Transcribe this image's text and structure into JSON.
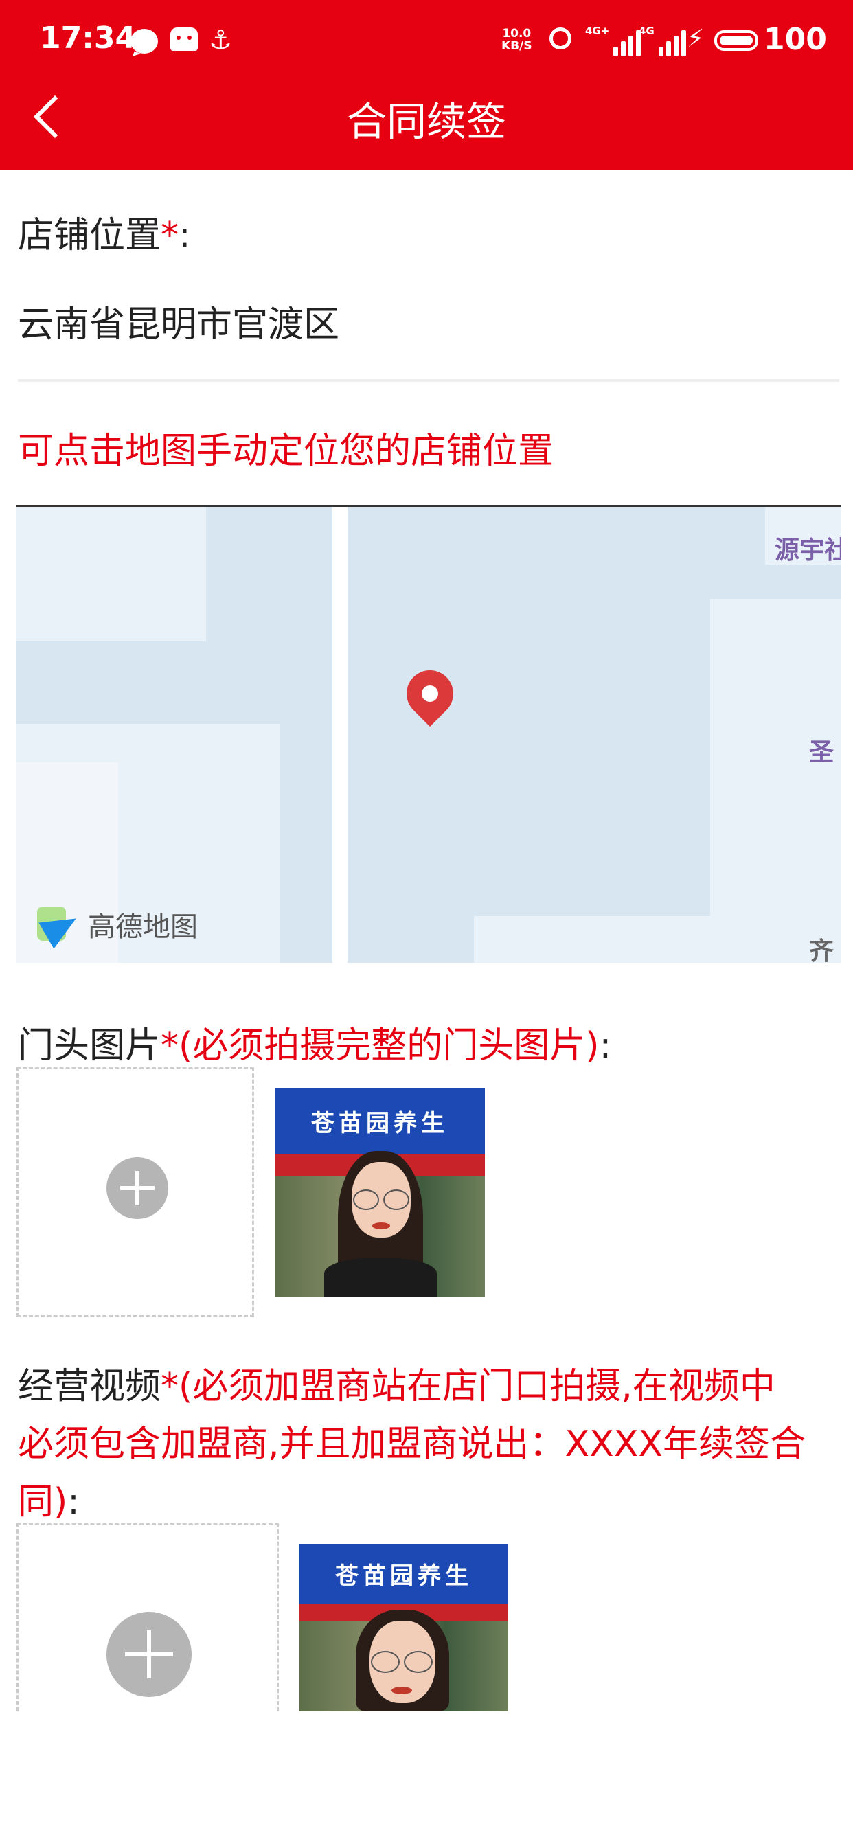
{
  "status_bar": {
    "time": "17:34",
    "net_speed_value": "10.0",
    "net_speed_unit": "KB/S",
    "signal1_label": "4G+",
    "signal2_label": "4G",
    "battery": "100"
  },
  "nav": {
    "title": "合同续签"
  },
  "store_location": {
    "label": "店铺位置",
    "required_mark": "*",
    "colon": ":",
    "value": "云南省昆明市官渡区"
  },
  "map_hint": "可点击地图手动定位您的店铺位置",
  "map": {
    "place_1": "源宇社",
    "place_2": "圣",
    "place_3": "齐",
    "provider": "高德地图"
  },
  "storefront": {
    "label": "门头图片",
    "required_mark": "*",
    "note": "(必须拍摄完整的门头图片)",
    "colon": ":",
    "sign_text": "苍苗园养生"
  },
  "video": {
    "label": "经营视频",
    "required_mark": "*",
    "note_line1": "(必须加盟商站在店门口拍摄,在视频中",
    "note_line2": "必须包含加盟商,并且加盟商说出：XXXX年续签合",
    "note_line3": "同)",
    "colon": ":",
    "sign_text": "苍苗园养生"
  },
  "colors": {
    "brand": "#e50012",
    "map_water": "#d8e6f1"
  }
}
